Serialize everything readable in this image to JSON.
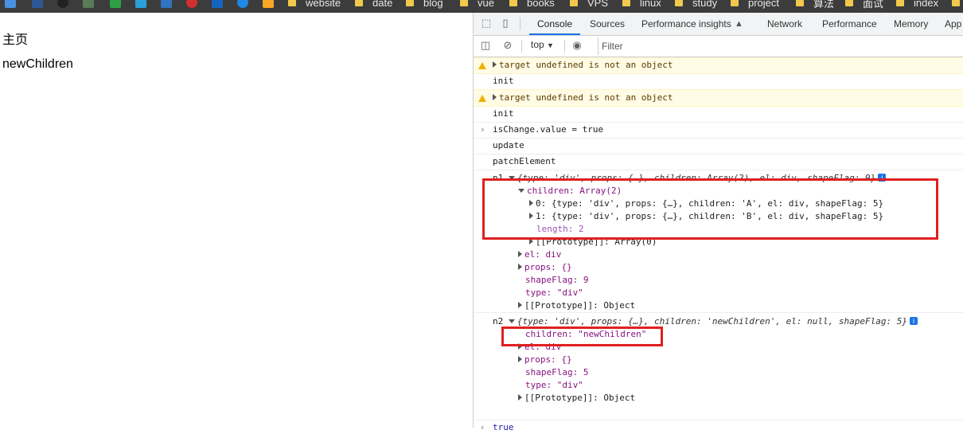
{
  "bookmarks": {
    "items": [
      "website",
      "date",
      "blog",
      "vue",
      "books",
      "VPS",
      "linux",
      "study",
      "project",
      "算法",
      "面试",
      "index"
    ]
  },
  "page": {
    "home_text": "主页",
    "content_text": "newChildren"
  },
  "devtools": {
    "tabs": [
      "Console",
      "Sources",
      "Performance insights",
      "Network",
      "Performance",
      "Memory",
      "App"
    ],
    "active_tab": "Console",
    "context_label": "top",
    "filter_placeholder": "Filter"
  },
  "console": {
    "warn1": "target undefined is not an object",
    "init1": "init",
    "warn2": "target undefined is not an object",
    "init2": "init",
    "input_cmd": "isChange.value = true",
    "update": "update",
    "patch": "patchElement",
    "n1": {
      "label": "n1",
      "summary": "{type: 'div', props: {…}, children: Array(2), el: div, shapeFlag: 9}",
      "children_label": "children: Array(2)",
      "child0": "0: {type: 'div', props: {…}, children: 'A', el: div, shapeFlag: 5}",
      "child1": "1: {type: 'div', props: {…}, children: 'B', el: div, shapeFlag: 5}",
      "length": "length: 2",
      "proto_array": "[[Prototype]]: Array(0)",
      "el": "el: div",
      "props": "props: {}",
      "shapeflag": "shapeFlag: 9",
      "type": "type: \"div\"",
      "proto": "[[Prototype]]: Object"
    },
    "n2": {
      "label": "n2",
      "summary": "{type: 'div', props: {…}, children: 'newChildren', el: null, shapeFlag: 5}",
      "children": "children: \"newChildren\"",
      "el": "el: div",
      "props": "props: {}",
      "shapeflag": "shapeFlag: 5",
      "type": "type: \"div\"",
      "proto": "[[Prototype]]: Object"
    },
    "result": "true"
  },
  "colors": {
    "annotation": "#e02020",
    "active_tab": "#1a73e8",
    "warning_bg": "#fffbe5"
  }
}
